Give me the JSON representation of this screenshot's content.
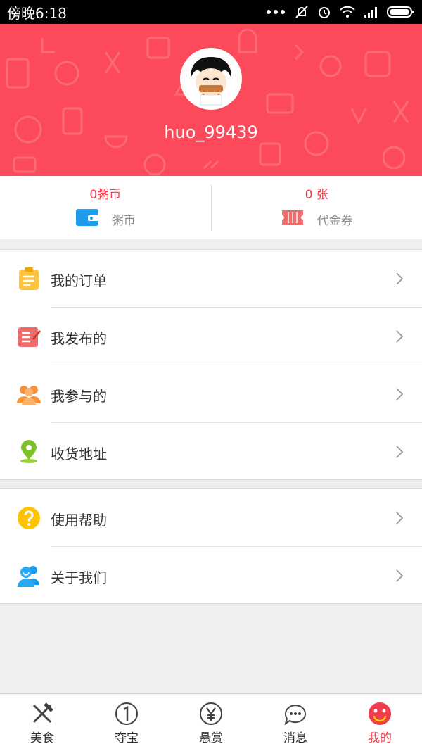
{
  "status_bar": {
    "time": "傍晚6:18"
  },
  "profile": {
    "username": "huo_99439"
  },
  "wallet": {
    "coins": {
      "value": "0粥币",
      "label": "粥币"
    },
    "vouchers": {
      "value": "0 张",
      "label": "代金券"
    }
  },
  "menu_primary": [
    {
      "label": "我的订单",
      "icon": "order-clipboard-icon"
    },
    {
      "label": "我发布的",
      "icon": "edit-note-icon"
    },
    {
      "label": "我参与的",
      "icon": "people-icon"
    },
    {
      "label": "收货地址",
      "icon": "location-pin-icon"
    }
  ],
  "menu_secondary": [
    {
      "label": "使用帮助",
      "icon": "help-icon"
    },
    {
      "label": "关于我们",
      "icon": "contact-icon"
    }
  ],
  "tabs": [
    {
      "label": "美食",
      "icon": "fork-knife-icon"
    },
    {
      "label": "夺宝",
      "icon": "number-one-icon"
    },
    {
      "label": "悬赏",
      "icon": "yen-icon"
    },
    {
      "label": "消息",
      "icon": "chat-bubble-icon"
    },
    {
      "label": "我的",
      "icon": "smiley-icon",
      "active": true
    }
  ],
  "colors": {
    "accent": "#fc4a5a",
    "accent_text": "#f03c4b",
    "background": "#efefef"
  }
}
